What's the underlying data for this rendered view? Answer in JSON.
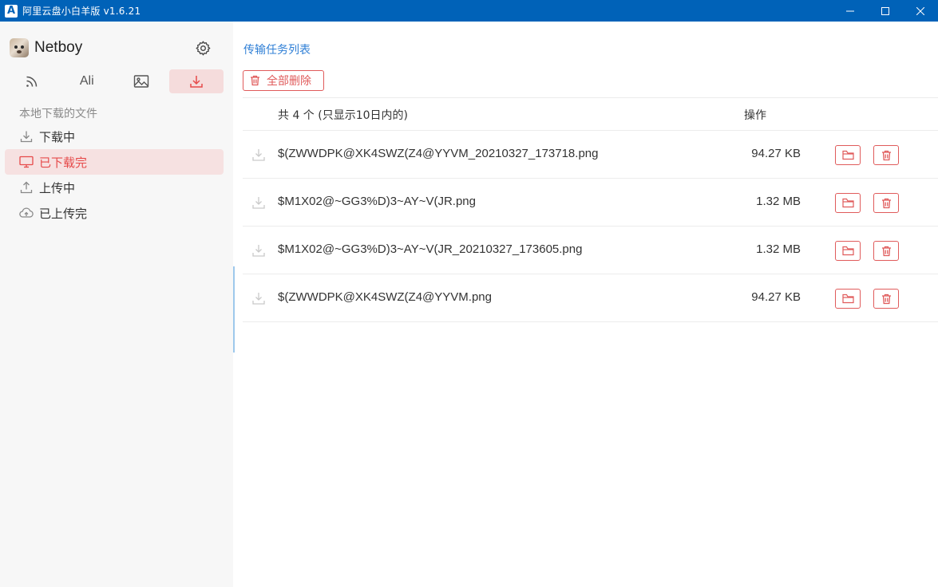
{
  "window": {
    "title": "阿里云盘小白羊版 v1.6.21",
    "app_icon_letter": "A"
  },
  "sidebar": {
    "user_name": "Netboy",
    "tabs": [
      {
        "icon": "rss-icon",
        "label": ""
      },
      {
        "icon": "",
        "label": "Ali"
      },
      {
        "icon": "image-icon",
        "label": ""
      },
      {
        "icon": "download-icon",
        "label": ""
      }
    ],
    "section_label": "本地下载的文件",
    "items": [
      {
        "label": "下载中",
        "icon": "download-icon"
      },
      {
        "label": "已下载完",
        "icon": "monitor-icon"
      },
      {
        "label": "上传中",
        "icon": "upload-icon"
      },
      {
        "label": "已上传完",
        "icon": "cloud-upload-icon"
      }
    ]
  },
  "main": {
    "title": "传输任务列表",
    "delete_all_label": "全部删除",
    "summary": "共 4 个 (只显示10日内的)",
    "ops_header": "操作",
    "rows": [
      {
        "name": "$(ZWWDPK@XK4SWZ(Z4@YYVM_20210327_173718.png",
        "size": "94.27 KB"
      },
      {
        "name": "$M1X02@~GG3%D)3~AY~V(JR.png",
        "size": "1.32 MB"
      },
      {
        "name": "$M1X02@~GG3%D)3~AY~V(JR_20210327_173605.png",
        "size": "1.32 MB"
      },
      {
        "name": "$(ZWWDPK@XK4SWZ(Z4@YYVM.png",
        "size": "94.27 KB"
      }
    ]
  },
  "colors": {
    "titlebar": "#0062b8",
    "accent_red": "#e05b5b",
    "link_blue": "#2f7fd6",
    "sidebar_bg": "#f7f7f7",
    "active_bg": "#f6e1e1"
  }
}
